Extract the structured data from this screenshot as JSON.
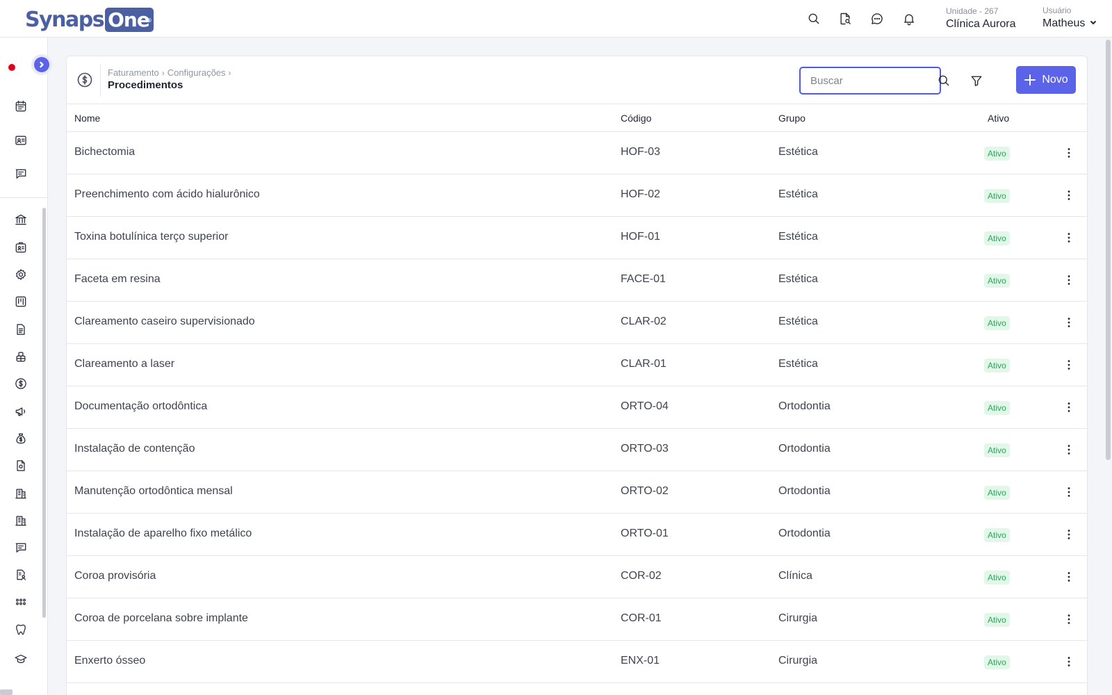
{
  "header": {
    "logo": {
      "part1": "Synaps",
      "part2": "One",
      "registered": "®"
    },
    "unit": {
      "label": "Unidade - 267",
      "value": "Clínica Aurora"
    },
    "user": {
      "label": "Usuário",
      "value": "Matheus"
    },
    "icons": [
      "search-icon",
      "document-search-icon",
      "chat-icon",
      "bell-icon"
    ]
  },
  "page": {
    "breadcrumb": [
      "Faturamento",
      "Configurações"
    ],
    "title": "Procedimentos",
    "search_placeholder": "Buscar",
    "new_button": "Novo"
  },
  "table": {
    "columns": [
      "Nome",
      "Código",
      "Grupo",
      "Ativo"
    ],
    "rows": [
      {
        "name": "Bichectomia",
        "code": "HOF-03",
        "group": "Estética",
        "status": "Ativo"
      },
      {
        "name": "Preenchimento com ácido hialurônico",
        "code": "HOF-02",
        "group": "Estética",
        "status": "Ativo"
      },
      {
        "name": "Toxina botulínica terço superior",
        "code": "HOF-01",
        "group": "Estética",
        "status": "Ativo"
      },
      {
        "name": "Faceta em resina",
        "code": "FACE-01",
        "group": "Estética",
        "status": "Ativo"
      },
      {
        "name": "Clareamento caseiro supervisionado",
        "code": "CLAR-02",
        "group": "Estética",
        "status": "Ativo"
      },
      {
        "name": "Clareamento a laser",
        "code": "CLAR-01",
        "group": "Estética",
        "status": "Ativo"
      },
      {
        "name": "Documentação ortodôntica",
        "code": "ORTO-04",
        "group": "Ortodontia",
        "status": "Ativo"
      },
      {
        "name": "Instalação de contenção",
        "code": "ORTO-03",
        "group": "Ortodontia",
        "status": "Ativo"
      },
      {
        "name": "Manutenção ortodôntica mensal",
        "code": "ORTO-02",
        "group": "Ortodontia",
        "status": "Ativo"
      },
      {
        "name": "Instalação de aparelho fixo metálico",
        "code": "ORTO-01",
        "group": "Ortodontia",
        "status": "Ativo"
      },
      {
        "name": "Coroa provisória",
        "code": "COR-02",
        "group": "Clínica",
        "status": "Ativo"
      },
      {
        "name": "Coroa de porcelana sobre implante",
        "code": "COR-01",
        "group": "Cirurgia",
        "status": "Ativo"
      },
      {
        "name": "Enxerto ósseo",
        "code": "ENX-01",
        "group": "Cirurgia",
        "status": "Ativo"
      }
    ]
  },
  "sidebar": {
    "icons": [
      "calendar-icon",
      "id-card-icon",
      "message-icon",
      "bank-icon",
      "badge-icon",
      "gear-icon",
      "kanban-icon",
      "file-icon",
      "robot-icon",
      "dollar-icon",
      "megaphone-icon",
      "money-bag-icon",
      "document-icon",
      "building-icon",
      "building-icon",
      "message-icon",
      "user-report-icon",
      "apps-icon",
      "tooth-icon",
      "graduation-icon"
    ]
  },
  "colors": {
    "accent": "#5b64e8",
    "brand": "#4b5fa3",
    "active_bg": "#e3f7e9",
    "active_text": "#27a55a",
    "rec": "#e0001a"
  }
}
